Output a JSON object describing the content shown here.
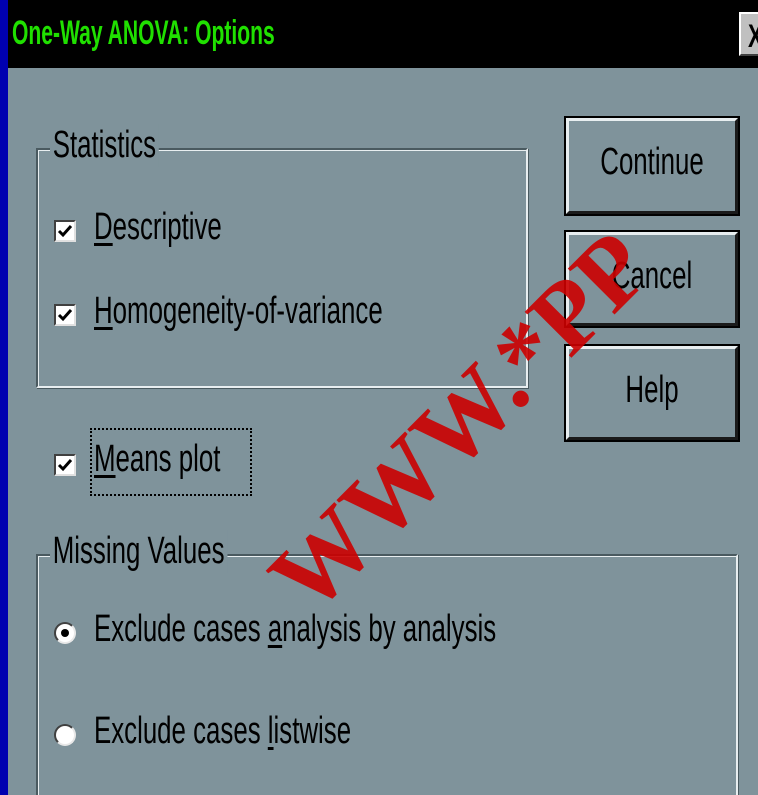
{
  "window": {
    "title": "One-Way ANOVA: Options",
    "close_label": "X"
  },
  "statistics": {
    "group_title": "Statistics",
    "descriptive": {
      "mnemonic": "D",
      "rest": "escriptive",
      "checked": true
    },
    "homogeneity": {
      "mnemonic": "H",
      "rest": "omogeneity-of-variance",
      "checked": true
    }
  },
  "means_plot": {
    "mnemonic": "M",
    "rest": "eans plot",
    "checked": true
  },
  "missing_values": {
    "group_title": "Missing Values",
    "options": [
      {
        "before": "Exclude cases ",
        "mnemonic": "a",
        "after": "nalysis by analysis",
        "selected": true
      },
      {
        "before": "Exclude cases ",
        "mnemonic": "l",
        "after": "istwise",
        "selected": false
      }
    ]
  },
  "buttons": {
    "continue": "Continue",
    "cancel": "Cancel",
    "help": "Help"
  },
  "watermark": "WWW.*PP",
  "colors": {
    "title_bar": "#000000",
    "title_text": "#20e000",
    "dialog_bg": "#7f939b",
    "watermark": "#cc0000",
    "frame": "#0000b0"
  }
}
